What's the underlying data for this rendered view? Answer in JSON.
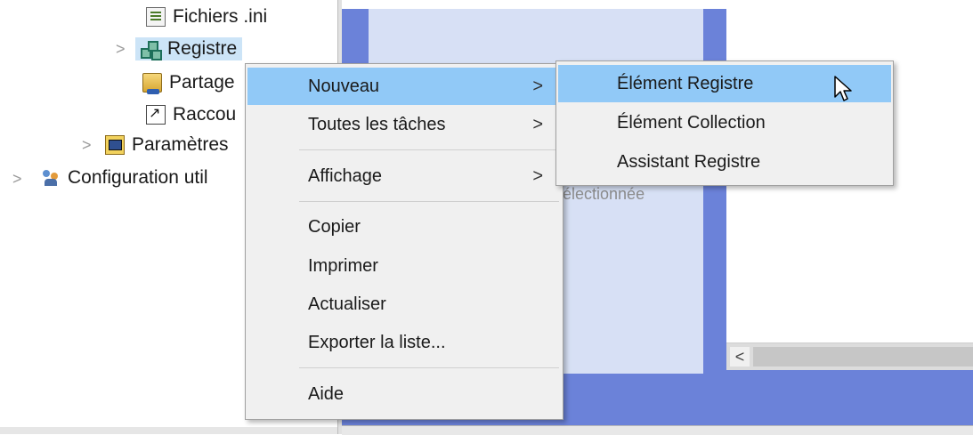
{
  "tree": {
    "items": [
      {
        "label": "Fichiers .ini",
        "icon": "ini-file-icon",
        "expandable": false
      },
      {
        "label": "Registre",
        "icon": "registry-icon",
        "expandable": true,
        "selected": true
      },
      {
        "label": "Partage",
        "icon": "shared-folder-icon",
        "expandable": false
      },
      {
        "label": "Raccou",
        "icon": "shortcut-icon",
        "expandable": false
      },
      {
        "label": "Paramètres",
        "icon": "settings-folder-icon",
        "expandable": true
      },
      {
        "label": "Configuration util",
        "icon": "users-icon",
        "expandable": true
      }
    ],
    "chevron": ">"
  },
  "context_menu": {
    "items": [
      {
        "label": "Nouveau",
        "has_submenu": true,
        "highlighted": true
      },
      {
        "label": "Toutes les tâches",
        "has_submenu": true
      },
      {
        "label": "Affichage",
        "has_submenu": true
      },
      {
        "label": "Copier"
      },
      {
        "label": "Imprimer"
      },
      {
        "label": "Actualiser"
      },
      {
        "label": "Exporter la liste..."
      },
      {
        "label": "Aide"
      }
    ],
    "submenu_arrow": ">"
  },
  "submenu": {
    "items": [
      {
        "label": "Élément Registre",
        "highlighted": true
      },
      {
        "label": "Élément Collection"
      },
      {
        "label": "Assistant Registre"
      }
    ]
  },
  "right_pane": {
    "partial_text": "électionnée",
    "scroll_left": "<"
  },
  "colors": {
    "menu_bg": "#f0f0f0",
    "menu_highlight": "#91c9f7",
    "pane_blue": "#6b82d9",
    "pane_light": "#d7e0f5",
    "tree_selected": "#cce4f7"
  }
}
